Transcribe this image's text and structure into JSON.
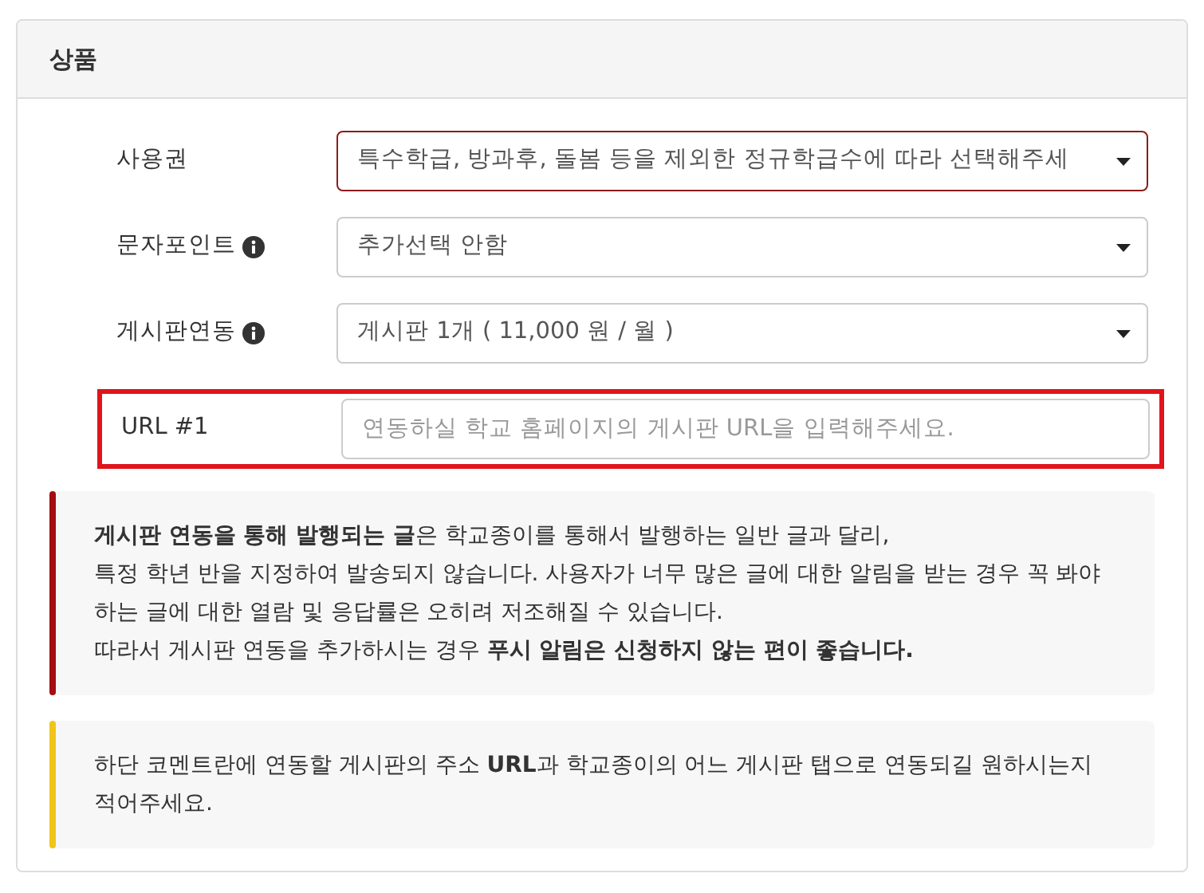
{
  "panel": {
    "title": "상품"
  },
  "fields": [
    {
      "kind": "select",
      "label": "사용권",
      "info": false,
      "value": "특수학급, 방과후, 돌봄 등을 제외한 정규학급수에 따라 선택해주세",
      "invalid": true,
      "highlighted": false
    },
    {
      "kind": "select",
      "label": "문자포인트",
      "info": true,
      "value": "추가선택 안함",
      "invalid": false,
      "highlighted": false
    },
    {
      "kind": "select",
      "label": "게시판연동",
      "info": true,
      "value": "게시판 1개 ( 11,000 원 / 월 )",
      "invalid": false,
      "highlighted": false
    },
    {
      "kind": "input",
      "label": "URL #1",
      "info": false,
      "placeholder": "연동하실 학교 홈페이지의 게시판 URL을 입력해주세요.",
      "invalid": false,
      "highlighted": true
    }
  ],
  "callouts": [
    {
      "color": "#a30d11",
      "text": "**게시판 연동을 통해 발행되는 글**은 학교종이를 통해서 발행하는 일반 글과 달리,\n특정 학년 반을 지정하여 발송되지 않습니다. 사용자가 너무 많은 글에 대한 알림을 받는 경우 꼭 봐야하는 글에 대한 열람 및 응답률은 오히려 저조해질 수 있습니다.\n따라서 게시판 연동을 추가하시는 경우 **푸시 알림은 신청하지 않는 편이 좋습니다.**"
    },
    {
      "color": "#f0c419",
      "text": "하단 코멘트란에 연동할 게시판의 주소 **URL**과 학교종이의 어느 게시판 탭으로 연동되길 원하시는지 적어주세요."
    }
  ]
}
